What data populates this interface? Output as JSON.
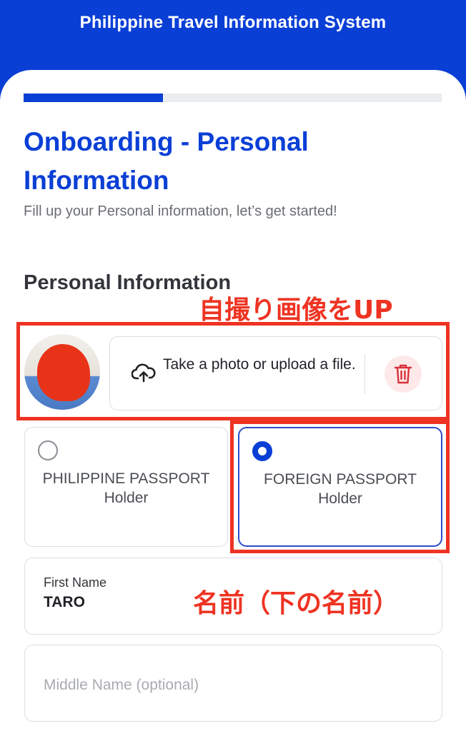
{
  "header": {
    "title": "Philippine Travel Information System"
  },
  "progress": {
    "fraction": 0.333
  },
  "page": {
    "title": "Onboarding - Personal Information",
    "subtitle": "Fill up your Personal information, let’s get started!",
    "section_title": "Personal Information"
  },
  "photo": {
    "upload_text": "Take a photo or upload a file.",
    "upload_icon": "cloud-upload-icon",
    "delete_icon": "trash-icon"
  },
  "passport": {
    "options": [
      {
        "line1": "PHILIPPINE PASSPORT",
        "line2": "Holder",
        "selected": false
      },
      {
        "line1": "FOREIGN PASSPORT",
        "line2": "Holder",
        "selected": true
      }
    ]
  },
  "fields": {
    "first_name": {
      "label": "First Name",
      "value": "TARO"
    },
    "middle_name": {
      "placeholder": "Middle Name (optional)"
    }
  },
  "annotations": {
    "selfie": "自撮り画像をUP",
    "name": "名前（下の名前）"
  },
  "colors": {
    "brand": "#0a3fd6",
    "annotation": "#ee3322",
    "delete_bg": "#fde9ea",
    "delete_icon": "#d9323b"
  }
}
